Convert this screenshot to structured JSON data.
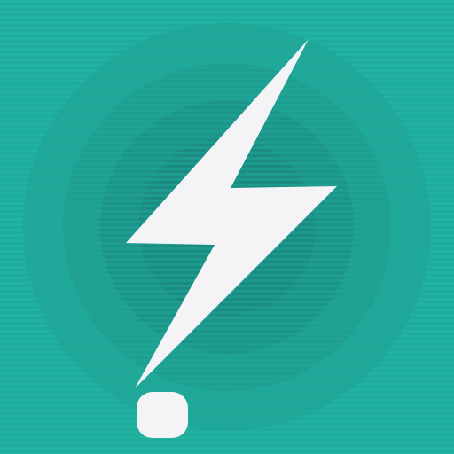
{
  "app_icon": {
    "icon_name": "lightning-bolt-with-dot-icon",
    "colors": {
      "background": "#21b2a1",
      "stripe": "#1ea797",
      "ring_outer": "#20a89a",
      "ring_second": "#1f9e92",
      "ring_third": "#1d948a",
      "ring_center": "#1c8b82",
      "glyph": "#f4f4f6"
    }
  }
}
